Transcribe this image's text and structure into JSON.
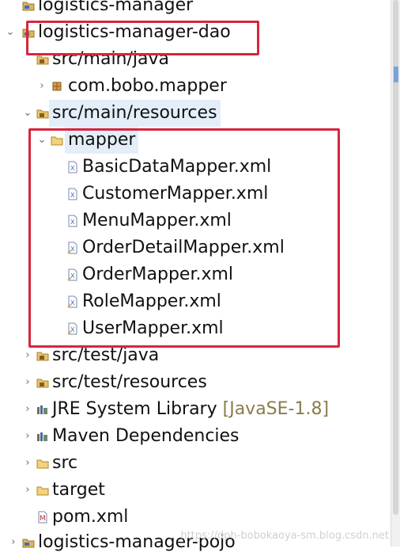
{
  "tree": {
    "rows": [
      {
        "label": "logistics-manager",
        "arrow": "",
        "icon": "project-icon"
      },
      {
        "label": "logistics-manager-dao",
        "arrow": "⌄",
        "icon": "project-icon"
      },
      {
        "label": "src/main/java",
        "arrow": "",
        "icon": "source-folder-icon"
      },
      {
        "label": "com.bobo.mapper",
        "arrow": "›",
        "icon": "package-icon"
      },
      {
        "label": "src/main/resources",
        "arrow": "⌄",
        "icon": "source-folder-icon"
      },
      {
        "label": "mapper",
        "arrow": "⌄",
        "icon": "folder-icon"
      },
      {
        "label": "BasicDataMapper.xml",
        "arrow": "",
        "icon": "xml-file-icon"
      },
      {
        "label": "CustomerMapper.xml",
        "arrow": "",
        "icon": "xml-file-icon"
      },
      {
        "label": "MenuMapper.xml",
        "arrow": "",
        "icon": "xml-file-icon"
      },
      {
        "label": "OrderDetailMapper.xml",
        "arrow": "",
        "icon": "xml-file-icon"
      },
      {
        "label": "OrderMapper.xml",
        "arrow": "",
        "icon": "xml-file-icon"
      },
      {
        "label": "RoleMapper.xml",
        "arrow": "",
        "icon": "xml-file-icon"
      },
      {
        "label": "UserMapper.xml",
        "arrow": "",
        "icon": "xml-file-icon"
      },
      {
        "label": "src/test/java",
        "arrow": "›",
        "icon": "source-folder-icon"
      },
      {
        "label": "src/test/resources",
        "arrow": "›",
        "icon": "source-folder-icon"
      },
      {
        "label": "JRE System Library",
        "decoration": "[JavaSE-1.8]",
        "arrow": "›",
        "icon": "library-icon"
      },
      {
        "label": "Maven Dependencies",
        "arrow": "›",
        "icon": "library-icon"
      },
      {
        "label": "src",
        "arrow": "›",
        "icon": "folder-icon"
      },
      {
        "label": "target",
        "arrow": "›",
        "icon": "folder-icon"
      },
      {
        "label": "pom.xml",
        "arrow": "",
        "icon": "maven-pom-icon"
      },
      {
        "label": "logistics-manager-pojo",
        "arrow": "›",
        "icon": "project-icon"
      }
    ]
  },
  "watermark": "https://dph-bobokaoya-sm.blog.csdn.net",
  "colors": {
    "highlight_border": "#d7263d",
    "selection": "#e4eef9",
    "decoration_text": "#8a7b4a"
  }
}
